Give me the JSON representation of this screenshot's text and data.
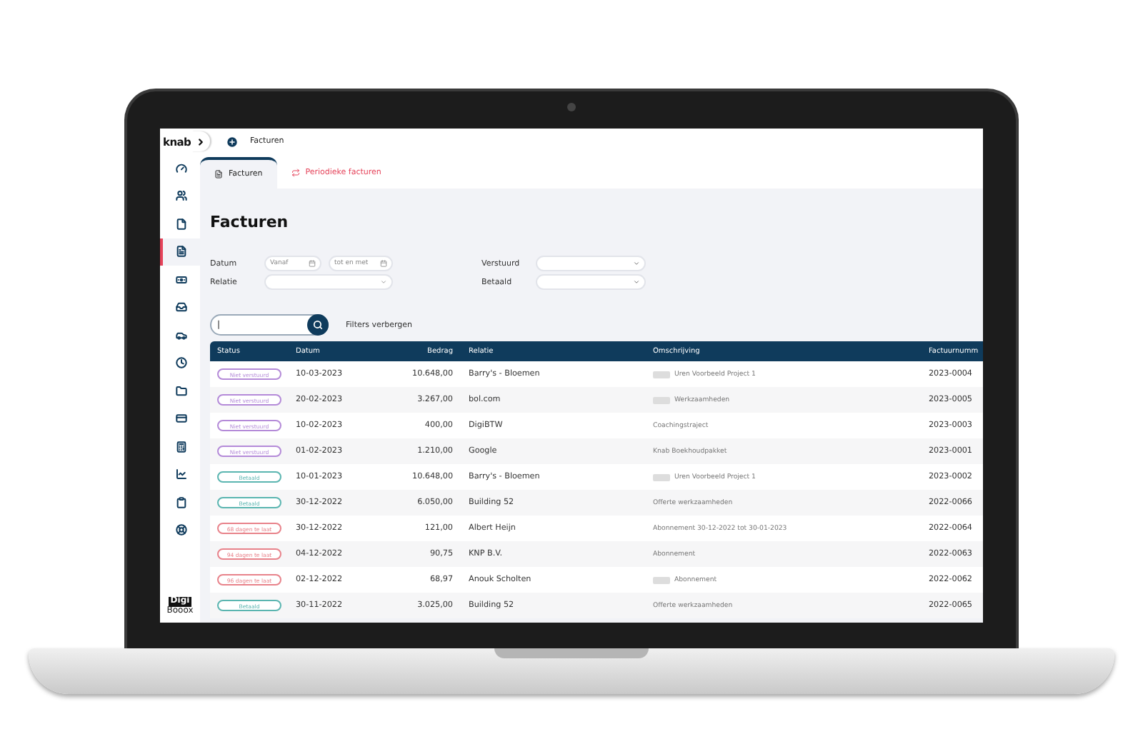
{
  "app": {
    "logo": "knab",
    "bottom_logo_top": "Digi",
    "bottom_logo_bottom": "Booox"
  },
  "breadcrumb": "Facturen",
  "sidebar": {
    "items": [
      {
        "selected": false
      },
      {
        "selected": false
      },
      {
        "selected": false
      },
      {
        "selected": true
      },
      {
        "selected": false
      },
      {
        "selected": false
      },
      {
        "selected": false
      },
      {
        "selected": false
      },
      {
        "selected": false
      },
      {
        "selected": false
      },
      {
        "selected": false
      },
      {
        "selected": false
      },
      {
        "selected": false
      },
      {
        "selected": false
      }
    ]
  },
  "tabs": [
    {
      "label": "Facturen",
      "selected": true
    },
    {
      "label": "Periodieke facturen",
      "selected": false
    }
  ],
  "title": "Facturen",
  "filters": {
    "datum_label": "Datum",
    "from_placeholder": "Vanaf",
    "to_placeholder": "tot en met",
    "relatie_label": "Relatie",
    "verstuurd_label": "Verstuurd",
    "betaald_label": "Betaald"
  },
  "search": {
    "value": "|",
    "toggle_link": "Filters verbergen"
  },
  "table": {
    "columns": [
      "Status",
      "Datum",
      "Bedrag",
      "Relatie",
      "Omschrijving",
      "Factuurnumm"
    ],
    "rows": [
      {
        "status": "Niet verstuurd",
        "color": "#b48ad8",
        "datum": "10-03-2023",
        "bedrag": "10.648,00",
        "relatie": "Barry's - Bloemen",
        "icon": true,
        "omschrijving": "Uren Voorbeeld Project 1",
        "nummer": "2023-0004"
      },
      {
        "status": "Niet verstuurd",
        "color": "#b48ad8",
        "datum": "20-02-2023",
        "bedrag": "3.267,00",
        "relatie": "bol.com",
        "icon": true,
        "omschrijving": "Werkzaamheden",
        "nummer": "2023-0005"
      },
      {
        "status": "Niet verstuurd",
        "color": "#b48ad8",
        "datum": "10-02-2023",
        "bedrag": "400,00",
        "relatie": "DigiBTW",
        "icon": false,
        "omschrijving": "Coachingstraject",
        "nummer": "2023-0003"
      },
      {
        "status": "Niet verstuurd",
        "color": "#b48ad8",
        "datum": "01-02-2023",
        "bedrag": "1.210,00",
        "relatie": "Google",
        "icon": false,
        "omschrijving": "Knab Boekhoudpakket",
        "nummer": "2023-0001"
      },
      {
        "status": "Betaald",
        "color": "#5ab5b0",
        "datum": "10-01-2023",
        "bedrag": "10.648,00",
        "relatie": "Barry's - Bloemen",
        "icon": true,
        "omschrijving": "Uren Voorbeeld Project 1",
        "nummer": "2023-0002"
      },
      {
        "status": "Betaald",
        "color": "#5ab5b0",
        "datum": "30-12-2022",
        "bedrag": "6.050,00",
        "relatie": "Building 52",
        "icon": false,
        "omschrijving": "Offerte werkzaamheden",
        "nummer": "2022-0066"
      },
      {
        "status": "68 dagen te laat",
        "color": "#e8828a",
        "datum": "30-12-2022",
        "bedrag": "121,00",
        "relatie": "Albert Heijn",
        "icon": false,
        "omschrijving": "Abonnement 30-12-2022 tot 30-01-2023",
        "nummer": "2022-0064"
      },
      {
        "status": "94 dagen te laat",
        "color": "#e8828a",
        "datum": "04-12-2022",
        "bedrag": "90,75",
        "relatie": "KNP B.V.",
        "icon": false,
        "omschrijving": "Abonnement",
        "nummer": "2022-0063"
      },
      {
        "status": "96 dagen te laat",
        "color": "#e8828a",
        "datum": "02-12-2022",
        "bedrag": "68,97",
        "relatie": "Anouk Scholten",
        "icon": true,
        "omschrijving": "Abonnement",
        "nummer": "2022-0062"
      },
      {
        "status": "Betaald",
        "color": "#5ab5b0",
        "datum": "30-11-2022",
        "bedrag": "3.025,00",
        "relatie": "Building 52",
        "icon": false,
        "omschrijving": "Offerte werkzaamheden",
        "nummer": "2022-0065"
      }
    ]
  }
}
